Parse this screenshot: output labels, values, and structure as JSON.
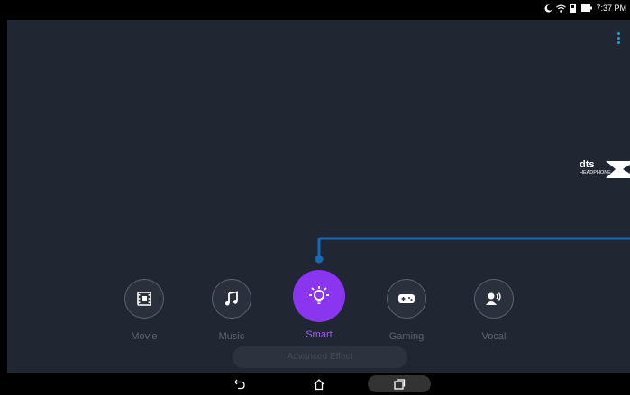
{
  "status_bar": {
    "time": "7:37 PM",
    "icons": [
      "moon-icon",
      "wifi-icon",
      "data-icon",
      "battery-icon"
    ]
  },
  "app": {
    "menu_icon": "more-vert-icon",
    "logo_lines": [
      "dts",
      "HEADPHONE"
    ],
    "accent_color": "#8a35f0",
    "connector_color": "#1868b8",
    "modes": [
      {
        "label": "Movie",
        "icon": "movie-icon",
        "active": false
      },
      {
        "label": "Music",
        "icon": "music-note-icon",
        "active": false
      },
      {
        "label": "Smart",
        "icon": "smart-bulb-icon",
        "active": true
      },
      {
        "label": "Gaming",
        "icon": "gamepad-icon",
        "active": false
      },
      {
        "label": "Vocal",
        "icon": "vocal-icon",
        "active": false
      }
    ],
    "advanced_effect_label": "Advanced Effect"
  },
  "nav_bar": {
    "icons": [
      "back-icon",
      "home-icon",
      "recents-icon"
    ]
  }
}
